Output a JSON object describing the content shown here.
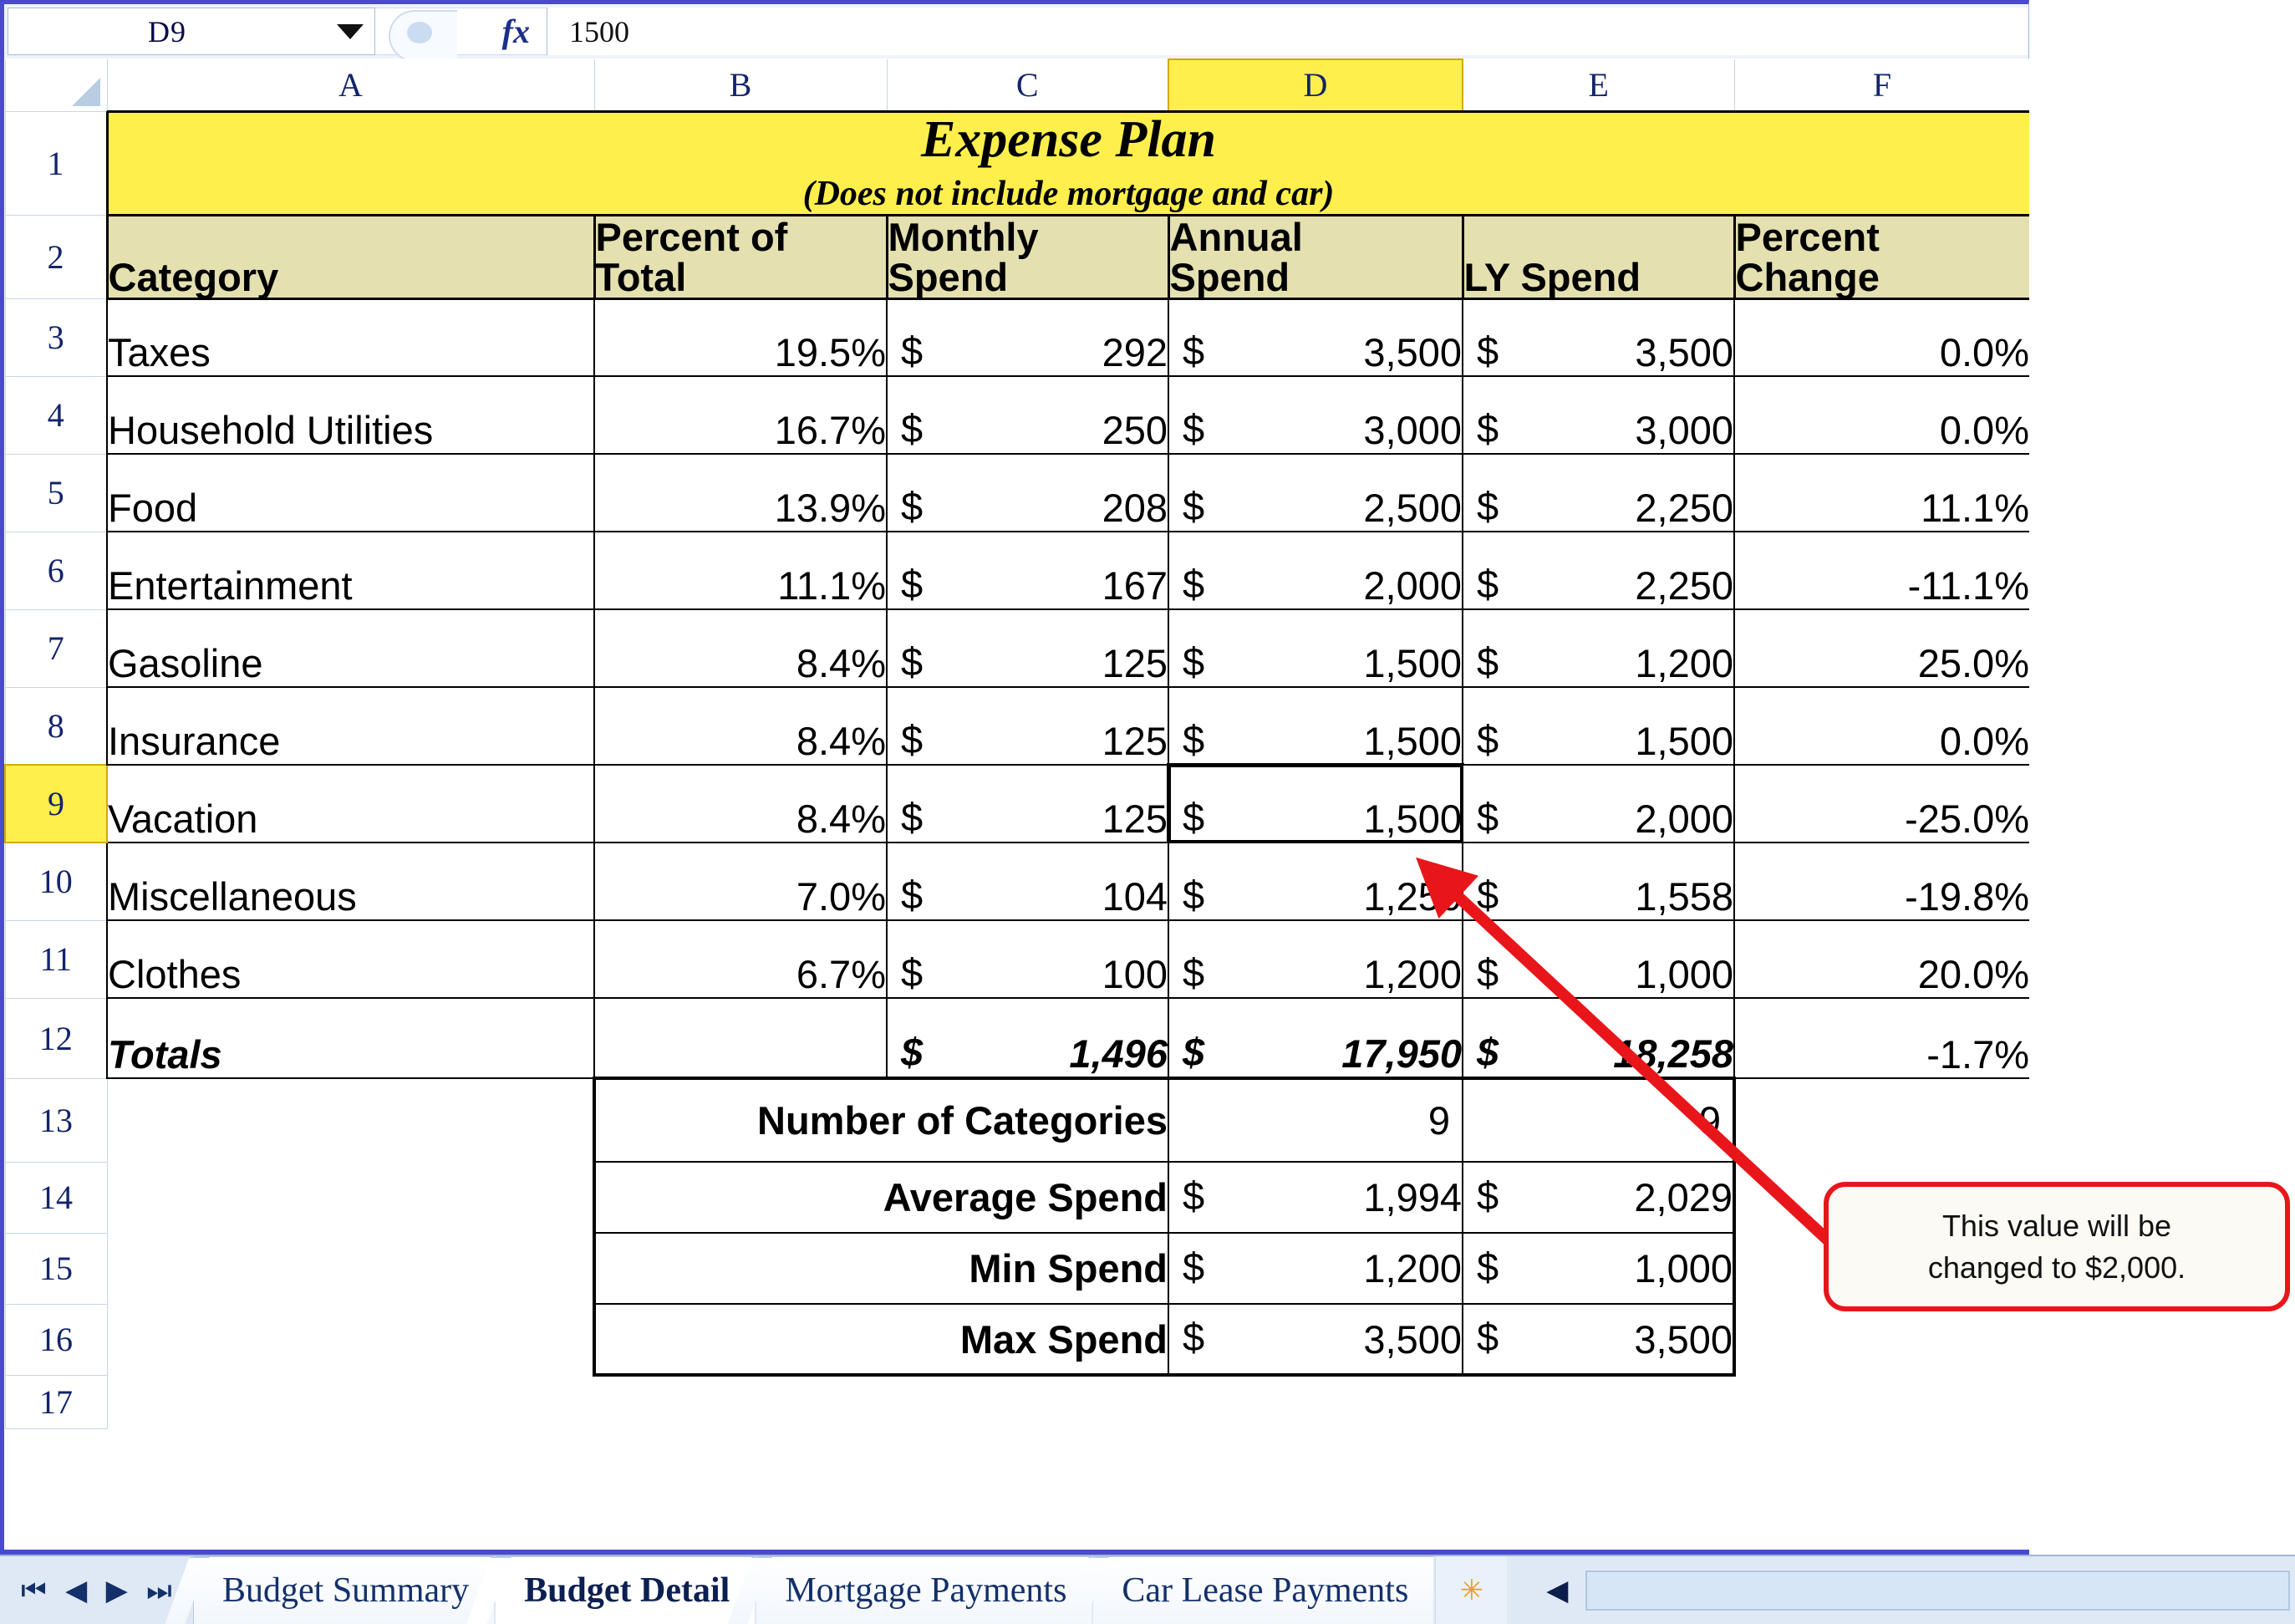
{
  "formula_bar": {
    "name_box_value": "D9",
    "formula_value": "1500",
    "fx_label": "fx",
    "dropdown_icon": "chevron-down-icon"
  },
  "column_headers": [
    "A",
    "B",
    "C",
    "D",
    "E",
    "F"
  ],
  "active_column": "D",
  "active_row": "9",
  "row_headers": [
    "1",
    "2",
    "3",
    "4",
    "5",
    "6",
    "7",
    "8",
    "9",
    "10",
    "11",
    "12",
    "13",
    "14",
    "15",
    "16",
    "17"
  ],
  "title": {
    "main": "Expense Plan",
    "sub": "(Does not include mortgage and car)"
  },
  "table_headers": {
    "category": "Category",
    "percent_of_total_l1": "Percent of",
    "percent_of_total_l2": "Total",
    "monthly_spend_l1": "Monthly",
    "monthly_spend_l2": "Spend",
    "annual_spend_l1": "Annual",
    "annual_spend_l2": "Spend",
    "ly_spend": "LY Spend",
    "percent_change_l1": "Percent",
    "percent_change_l2": "Change"
  },
  "currency_symbol": "$",
  "rows": [
    {
      "row": "3",
      "category": "Taxes",
      "percent_of_total": "19.5%",
      "monthly_spend": "292",
      "annual_spend": "3,500",
      "ly_spend": "3,500",
      "percent_change": "0.0%"
    },
    {
      "row": "4",
      "category": "Household Utilities",
      "percent_of_total": "16.7%",
      "monthly_spend": "250",
      "annual_spend": "3,000",
      "ly_spend": "3,000",
      "percent_change": "0.0%"
    },
    {
      "row": "5",
      "category": "Food",
      "percent_of_total": "13.9%",
      "monthly_spend": "208",
      "annual_spend": "2,500",
      "ly_spend": "2,250",
      "percent_change": "11.1%"
    },
    {
      "row": "6",
      "category": "Entertainment",
      "percent_of_total": "11.1%",
      "monthly_spend": "167",
      "annual_spend": "2,000",
      "ly_spend": "2,250",
      "percent_change": "-11.1%"
    },
    {
      "row": "7",
      "category": "Gasoline",
      "percent_of_total": "8.4%",
      "monthly_spend": "125",
      "annual_spend": "1,500",
      "ly_spend": "1,200",
      "percent_change": "25.0%"
    },
    {
      "row": "8",
      "category": "Insurance",
      "percent_of_total": "8.4%",
      "monthly_spend": "125",
      "annual_spend": "1,500",
      "ly_spend": "1,500",
      "percent_change": "0.0%"
    },
    {
      "row": "9",
      "category": "Vacation",
      "percent_of_total": "8.4%",
      "monthly_spend": "125",
      "annual_spend": "1,500",
      "ly_spend": "2,000",
      "percent_change": "-25.0%"
    },
    {
      "row": "10",
      "category": "Miscellaneous",
      "percent_of_total": "7.0%",
      "monthly_spend": "104",
      "annual_spend": "1,250",
      "ly_spend": "1,558",
      "percent_change": "-19.8%"
    },
    {
      "row": "11",
      "category": "Clothes",
      "percent_of_total": "6.7%",
      "monthly_spend": "100",
      "annual_spend": "1,200",
      "ly_spend": "1,000",
      "percent_change": "20.0%"
    }
  ],
  "totals_row": {
    "row": "12",
    "label": "Totals",
    "monthly_spend": "1,496",
    "annual_spend": "17,950",
    "ly_spend": "18,258",
    "percent_change": "-1.7%"
  },
  "summary_rows": [
    {
      "row": "13",
      "label": "Number of Categories",
      "annual": "9",
      "ly": "9",
      "currency": false
    },
    {
      "row": "14",
      "label": "Average Spend",
      "annual": "1,994",
      "ly": "2,029",
      "currency": true
    },
    {
      "row": "15",
      "label": "Min Spend",
      "annual": "1,200",
      "ly": "1,000",
      "currency": true
    },
    {
      "row": "16",
      "label": "Max Spend",
      "annual": "3,500",
      "ly": "3,500",
      "currency": true
    }
  ],
  "callout": {
    "line1": "This value will be",
    "line2": "changed to $2,000."
  },
  "sheet_tabs": [
    {
      "label": "Budget Summary",
      "active": false
    },
    {
      "label": "Budget Detail",
      "active": true
    },
    {
      "label": "Mortgage Payments",
      "active": false
    },
    {
      "label": "Car Lease Payments",
      "active": false
    }
  ],
  "nav_buttons": [
    "first-sheet",
    "previous-sheet",
    "next-sheet",
    "last-sheet"
  ],
  "insert_sheet_icon": "insert-worksheet-icon",
  "colors": {
    "title_fill": "#FFEF4D",
    "header_fill": "#E4E0B0",
    "active_header": "#FFEF4D",
    "callout_border": "#E8161A",
    "arrow": "#E8161A",
    "window_border": "#4A4AD0"
  }
}
